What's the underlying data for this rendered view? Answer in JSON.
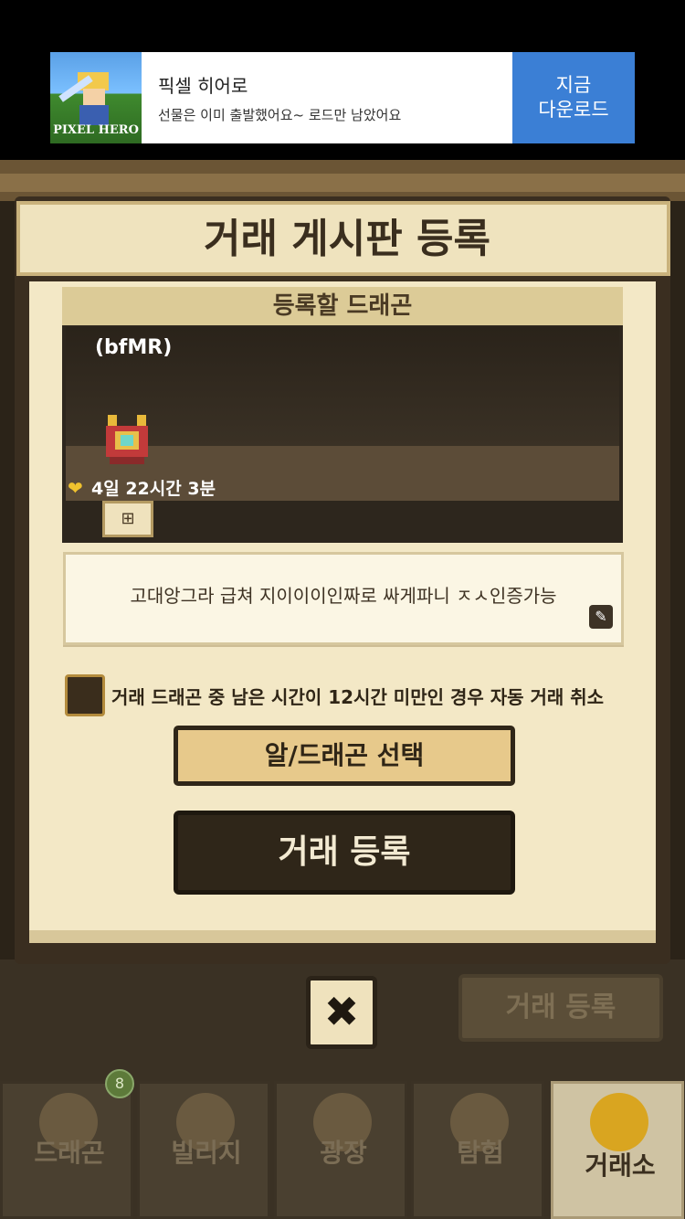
{
  "ad": {
    "logo_text": "PIXEL HERO",
    "title": "픽셀 히어로",
    "subtitle": "선물은 이미 출발했어요~ 로드만 남았어요",
    "cta_line1": "지금",
    "cta_line2": "다운로드"
  },
  "background": {
    "register_button": "거래 등록"
  },
  "dialog": {
    "title": "거래 게시판 등록",
    "section_header": "등록할 드래곤",
    "dragon": {
      "name": "(bfMR)",
      "time_remaining": "4일 22시간 3분"
    },
    "description": "고대앙그라 급쳐 지이이이인짜로 싸게파니 ㅈㅅ인증가능",
    "auto_cancel_label": "거래 드래곤 중 남은 시간이 12시간 미만인 경우 자동 거래 취소",
    "auto_cancel_checked": false,
    "select_button": "알/드래곤 선택",
    "register_button": "거래 등록",
    "close_symbol": "✖"
  },
  "nav": {
    "items": [
      {
        "label": "드래곤",
        "icon": "dragon-icon",
        "badge": "8"
      },
      {
        "label": "빌리지",
        "icon": "village-icon"
      },
      {
        "label": "광장",
        "icon": "plaza-icon"
      },
      {
        "label": "탐험",
        "icon": "compass-icon"
      },
      {
        "label": "거래소",
        "icon": "scales-icon",
        "active": true
      }
    ]
  }
}
